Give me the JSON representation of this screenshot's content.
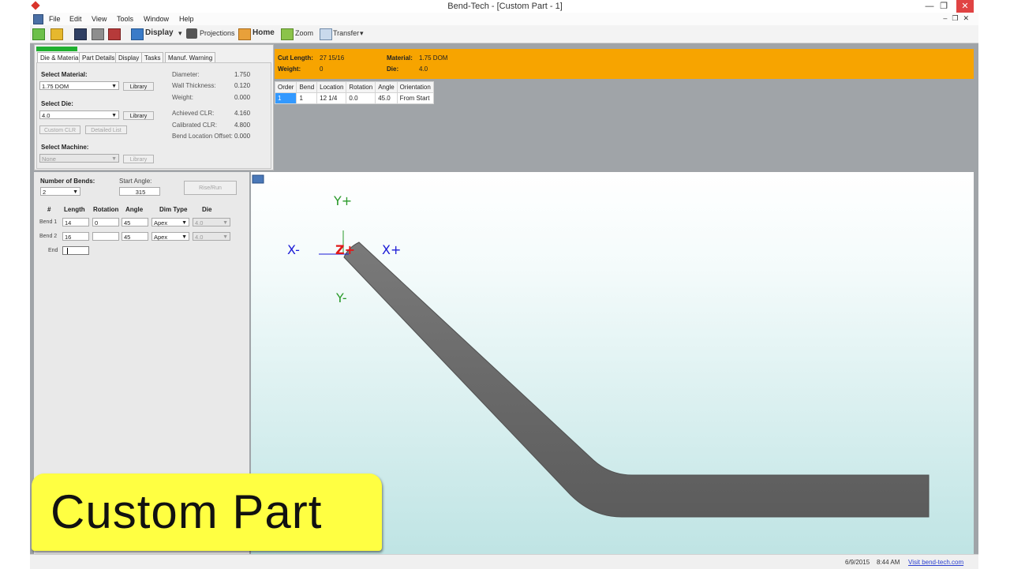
{
  "window": {
    "title": "Bend-Tech - [Custom Part - 1]"
  },
  "menu": {
    "items": [
      "File",
      "Edit",
      "View",
      "Tools",
      "Window",
      "Help"
    ]
  },
  "toolbar": {
    "display": "Display",
    "projections": "Projections",
    "home": "Home",
    "zoom": "Zoom",
    "transfer": "Transfer"
  },
  "tabs": [
    "Die & Material",
    "Part Details",
    "Display",
    "Tasks",
    "Manuf. Warning"
  ],
  "material": {
    "select_material_label": "Select Material:",
    "material_value": "1.75 DOM",
    "library_label": "Library",
    "select_die_label": "Select Die:",
    "die_value": "4.0",
    "custom_clr": "Custom CLR",
    "detailed_list": "Detailed List",
    "select_machine_label": "Select Machine:",
    "machine_value": "None",
    "props": [
      {
        "label": "Diameter:",
        "value": "1.750"
      },
      {
        "label": "Wall Thickness:",
        "value": "0.120"
      },
      {
        "label": "Weight:",
        "value": "0.000"
      },
      {
        "label": "Achieved CLR:",
        "value": "4.160"
      },
      {
        "label": "Calibrated CLR:",
        "value": "4.800"
      },
      {
        "label": "Bend Location Offset:",
        "value": "0.000"
      }
    ]
  },
  "bends": {
    "number_label": "Number of Bends:",
    "number_value": "2",
    "start_angle_label": "Start Angle:",
    "start_angle_value": "315",
    "rise_run": "Rise/Run",
    "headers": [
      "#",
      "Length",
      "Rotation",
      "Angle",
      "Dim Type",
      "Die"
    ],
    "rows": [
      {
        "label": "Bend 1",
        "length": "14",
        "rotation": "0",
        "angle": "45",
        "dim": "Apex",
        "die": "4.0"
      },
      {
        "label": "Bend 2",
        "length": "16",
        "rotation": "",
        "angle": "45",
        "dim": "Apex",
        "die": "4.0"
      }
    ],
    "end_label": "End",
    "end_value": ""
  },
  "info": {
    "cut_length_label": "Cut Length:",
    "cut_length_value": "27 15/16",
    "weight_label": "Weight:",
    "weight_value": "0",
    "material_label": "Material:",
    "material_value": "1.75 DOM",
    "die_label": "Die:",
    "die_value": "4.0"
  },
  "bend_table": {
    "headers": [
      "Order",
      "Bend",
      "Location",
      "Rotation",
      "Angle",
      "Orientation"
    ],
    "rows": [
      [
        "1",
        "1",
        "12 1/4",
        "0.0",
        "45.0",
        "From Start"
      ]
    ]
  },
  "viewport": {
    "axes": {
      "y_plus": "Y+",
      "y_minus": "Y-",
      "x_minus": "X-",
      "x_plus": "X+",
      "z_plus": "Z+"
    },
    "colors": {
      "x_axis": "#1a1ad6",
      "y_axis": "#2a9a2a",
      "z_axis": "#e01818",
      "tube": "#6b6b6b"
    }
  },
  "status": {
    "date": "6/9/2015",
    "time": "8:44 AM",
    "link": "Visit bend-tech.com"
  },
  "overlay": {
    "text": "Custom Part"
  },
  "colors": {
    "info_bar": "#f7a400",
    "overlay_bg": "#ffff42",
    "selected_cell": "#3399ff"
  }
}
